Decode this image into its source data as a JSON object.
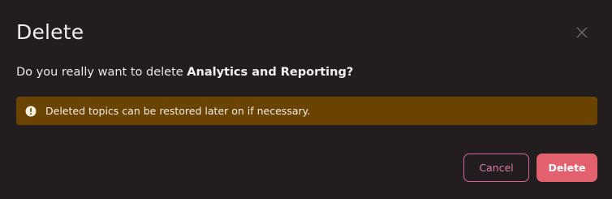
{
  "dialog": {
    "title": "Delete",
    "message_prefix": "Do you really want to delete ",
    "item_name": "Analytics and Reporting",
    "message_suffix": "?",
    "alert": {
      "text": "Deleted topics can be restored later on if necessary.",
      "icon": "warning-icon",
      "color": "#6a4300"
    },
    "close_icon": "close-icon",
    "buttons": {
      "cancel_label": "Cancel",
      "delete_label": "Delete"
    },
    "colors": {
      "background": "#221e20",
      "danger": "#e3616f",
      "cancel_border": "#d8679a"
    }
  }
}
